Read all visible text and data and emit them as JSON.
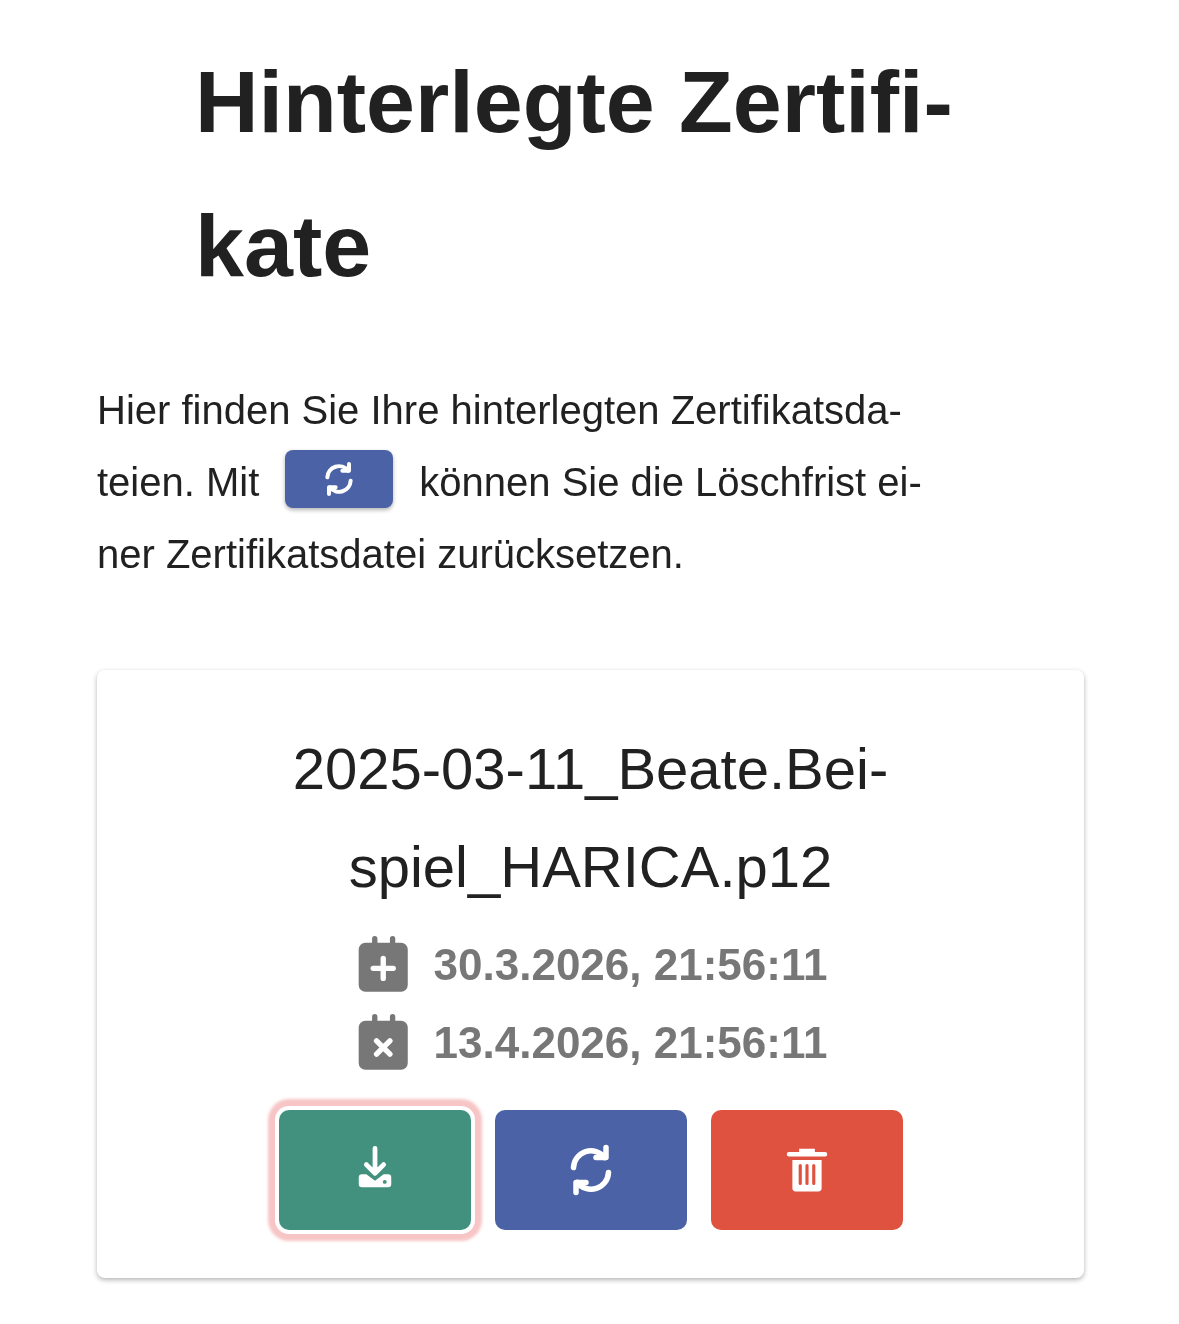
{
  "title_lines": [
    "Hinterlegte Zertifi-",
    "kate"
  ],
  "intro": {
    "line_1": "Hier finden Sie Ihre hinterlegten Zertifikatsda-",
    "before_button": "teien. Mit",
    "after_button": "können Sie die Löschfrist ei-",
    "line_3": "ner Zertifikatsdatei zurücksetzen."
  },
  "certificates": [
    {
      "filename_lines": [
        "2025-03-11_Beate.Bei-",
        "spiel_HARICA.p12"
      ],
      "dates": [
        {
          "kind": "created",
          "text": "30.3.2026, 21:56:11"
        },
        {
          "kind": "expires",
          "text": "13.4.2026, 21:56:11"
        }
      ],
      "buttons": [
        {
          "kind": "download",
          "focused": true
        },
        {
          "kind": "renew",
          "focused": false
        },
        {
          "kind": "delete",
          "focused": false
        }
      ]
    }
  ]
}
